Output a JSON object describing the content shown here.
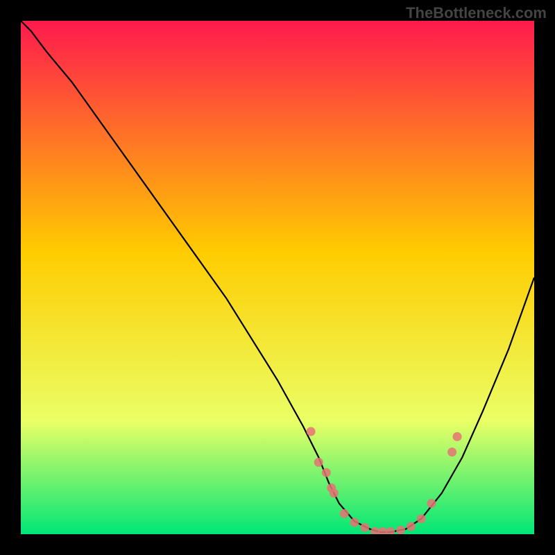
{
  "watermark": "TheBottleneck.com",
  "chart_data": {
    "type": "line",
    "title": "",
    "xlabel": "",
    "ylabel": "",
    "xlim": [
      0,
      100
    ],
    "ylim": [
      0,
      100
    ],
    "background_gradient": {
      "top": "#ff1a4d",
      "mid1": "#ffcc00",
      "mid2": "#eaff66",
      "bottom": "#00e676"
    },
    "curve": {
      "x": [
        0,
        2,
        5,
        10,
        15,
        20,
        25,
        30,
        35,
        40,
        45,
        50,
        55,
        58,
        60,
        62,
        65,
        68,
        70,
        72,
        75,
        78,
        82,
        86,
        90,
        95,
        100
      ],
      "y": [
        100,
        98,
        94,
        88,
        81,
        74,
        67,
        60,
        53,
        46,
        38,
        30,
        21,
        15,
        10,
        6,
        2.5,
        1,
        0.4,
        0.4,
        1,
        3,
        8,
        15,
        24,
        36,
        50
      ]
    },
    "scatter": {
      "x": [
        56.5,
        58,
        59.5,
        60.5,
        61,
        63,
        65,
        67,
        69,
        70.5,
        72,
        74,
        76,
        78,
        80,
        84,
        85
      ],
      "y": [
        20,
        14,
        12,
        9,
        8,
        4,
        2.3,
        1.3,
        0.5,
        0.5,
        0.5,
        0.8,
        1.5,
        3,
        6,
        16,
        19
      ]
    }
  }
}
